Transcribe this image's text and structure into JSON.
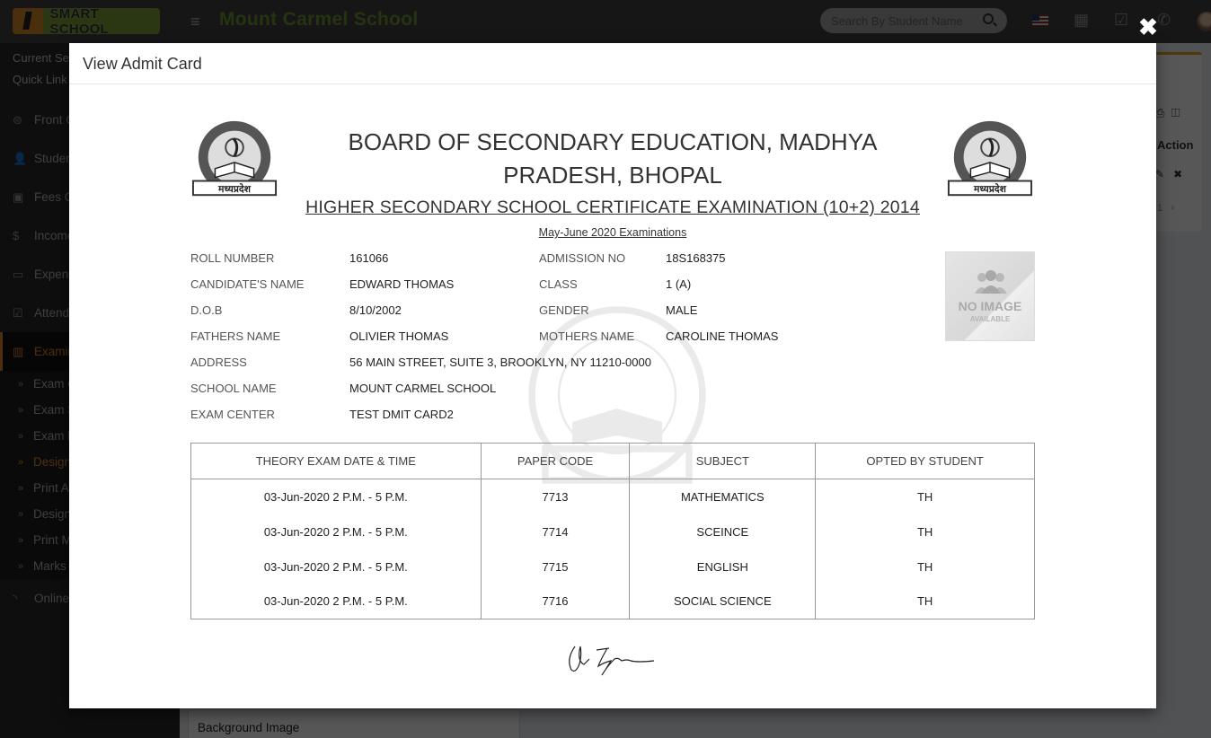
{
  "app": {
    "logo_text": "SMART SCHOOL",
    "school_name": "Mount Carmel School",
    "search_placeholder": "Search By Student Name",
    "header_icons": [
      "flag-us-icon",
      "calendar-icon",
      "check-square-icon",
      "whatsapp-icon",
      "avatar"
    ]
  },
  "sidebar": {
    "top_links": [
      "Current Se",
      "Quick Link"
    ],
    "items": [
      {
        "label": "Front C",
        "icon": "front-office-icon"
      },
      {
        "label": "Studen",
        "icon": "student-icon"
      },
      {
        "label": "Fees C",
        "icon": "money-icon"
      },
      {
        "label": "Income",
        "icon": "dollar-icon"
      },
      {
        "label": "Expens",
        "icon": "credit-card-icon"
      },
      {
        "label": "Attend",
        "icon": "calendar-check-icon"
      },
      {
        "label": "Examin",
        "icon": "map-icon",
        "active": true
      }
    ],
    "subitems": [
      {
        "label": "Exam G"
      },
      {
        "label": "Exam S"
      },
      {
        "label": "Exam R"
      },
      {
        "label": "Design",
        "active": true
      },
      {
        "label": "Print A"
      },
      {
        "label": "Design"
      },
      {
        "label": "Print M"
      },
      {
        "label": "Marks"
      }
    ],
    "after_items": [
      {
        "label": "Online",
        "icon": "rss-icon"
      }
    ]
  },
  "background_panel": {
    "action_header": "Action",
    "page_number": "1",
    "bottom_label": "Background Image"
  },
  "modal": {
    "title": "View Admit Card",
    "close_symbol": "✖"
  },
  "admit_card": {
    "board_title": "BOARD OF SECONDARY EDUCATION, MADHYA PRADESH, BHOPAL",
    "exam_title": "HIGHER SECONDARY SCHOOL CERTIFICATE EXAMINATION (10+2) 2014",
    "session": "May-June 2020 Examinations",
    "seal_text": "मध्यप्रदेश",
    "photo_placeholder": {
      "line1": "NO IMAGE",
      "line2": "AVAILABLE"
    },
    "fields_left": [
      {
        "label": "ROLL NUMBER",
        "value": "161066"
      },
      {
        "label": "CANDIDATE'S NAME",
        "value": "EDWARD THOMAS"
      },
      {
        "label": "D.O.B",
        "value": "8/10/2002"
      },
      {
        "label": "FATHERS NAME",
        "value": "OLIVIER THOMAS"
      },
      {
        "label": "ADDRESS",
        "value": "56 MAIN STREET, SUITE 3, BROOKLYN, NY 11210-0000"
      },
      {
        "label": "SCHOOL NAME",
        "value": "MOUNT CARMEL SCHOOL"
      },
      {
        "label": "EXAM CENTER",
        "value": "TEST DMIT CARD2"
      }
    ],
    "fields_right": [
      {
        "label": "ADMISSION NO",
        "value": "18S168375"
      },
      {
        "label": "CLASS",
        "value": "1 (A)"
      },
      {
        "label": "GENDER",
        "value": "MALE"
      },
      {
        "label": "MOTHERS NAME",
        "value": "CAROLINE THOMAS"
      }
    ],
    "table": {
      "headers": [
        "THEORY EXAM DATE & TIME",
        "PAPER CODE",
        "SUBJECT",
        "OPTED BY STUDENT"
      ],
      "rows": [
        [
          "03-Jun-2020 2 P.M. - 5 P.M.",
          "7713",
          "MATHEMATICS",
          "TH"
        ],
        [
          "03-Jun-2020 2 P.M. - 5 P.M.",
          "7714",
          "SCEINCE",
          "TH"
        ],
        [
          "03-Jun-2020 2 P.M. - 5 P.M.",
          "7715",
          "ENGLISH",
          "TH"
        ],
        [
          "03-Jun-2020 2 P.M. - 5 P.M.",
          "7716",
          "SOCIAL SCIENCE",
          "TH"
        ]
      ]
    }
  }
}
